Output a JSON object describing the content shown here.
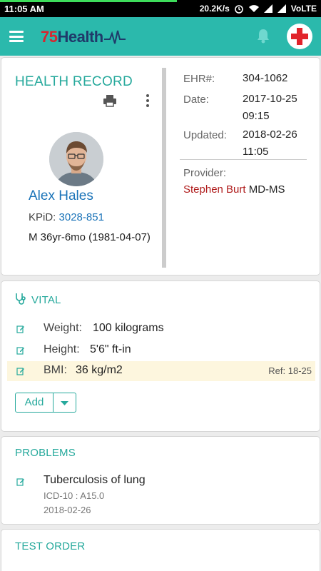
{
  "statusbar": {
    "time": "11:05 AM",
    "speed": "20.2K/s",
    "network": "VoLTE"
  },
  "appbar": {
    "logo_number": "75",
    "logo_word": "Health",
    "icons": [
      "menu-icon",
      "bell-icon",
      "red-cross-icon"
    ],
    "colors": {
      "bar": "#2bb9ac",
      "logo_red": "#d8262f",
      "logo_navy": "#1f3a6a"
    }
  },
  "record": {
    "title": "HEALTH RECORD",
    "patient_name": "Alex Hales",
    "kpid_label": "KPiD:",
    "kpid_value": "3028-851",
    "demographics": "M 36yr-6mo (1981-04-07)",
    "ehr_label": "EHR#:",
    "ehr_value": "304-1062",
    "date_label": "Date:",
    "date_value": "2017-10-25 09:15",
    "updated_label": "Updated:",
    "updated_value": "2018-02-26 11:05",
    "provider_label": "Provider:",
    "provider_name": "Stephen Burt",
    "provider_credential": "MD-MS"
  },
  "vital": {
    "title": "VITAL",
    "rows": [
      {
        "label": "Weight:",
        "value": "100 kilograms",
        "ref": ""
      },
      {
        "label": "Height:",
        "value": "5'6\" ft-in",
        "ref": ""
      },
      {
        "label": "BMI:",
        "value": "36 kg/m2",
        "ref": "Ref: 18-25"
      }
    ],
    "add_label": "Add"
  },
  "problems": {
    "title": "PROBLEMS",
    "items": [
      {
        "name": "Tuberculosis of lung",
        "code": "ICD-10 : A15.0",
        "date": "2018-02-26"
      }
    ]
  },
  "test_order": {
    "title": "TEST ORDER"
  }
}
